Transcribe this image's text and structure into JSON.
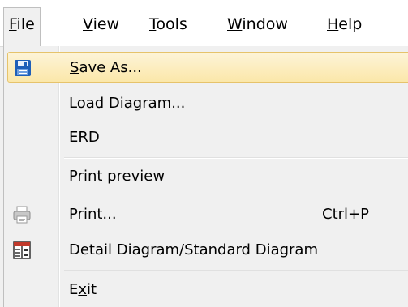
{
  "menubar": {
    "items": [
      {
        "mnemonic": "F",
        "rest": "ile"
      },
      {
        "mnemonic": "V",
        "rest": "iew"
      },
      {
        "mnemonic": "T",
        "rest": "ools"
      },
      {
        "mnemonic": "W",
        "rest": "indow"
      },
      {
        "mnemonic": "H",
        "rest": "elp"
      }
    ]
  },
  "file_menu": {
    "save_as": {
      "mnemonic": "S",
      "rest": "ave As...",
      "icon": "floppy-disk-icon"
    },
    "load_diagram": {
      "mnemonic": "L",
      "rest": "oad Diagram..."
    },
    "erd": {
      "label": "ERD"
    },
    "print_preview": {
      "label": "Print preview"
    },
    "print": {
      "mnemonic": "P",
      "rest": "rint...",
      "shortcut": "Ctrl+P",
      "icon": "printer-icon"
    },
    "detail_diagram": {
      "label": "Detail Diagram/Standard Diagram",
      "icon": "diagram-toggle-icon"
    },
    "exit": {
      "prefix": "E",
      "mnemonic": "x",
      "rest": "it"
    }
  },
  "colors": {
    "highlight": "#fbe7a9",
    "highlight_border": "#e6c36b",
    "menu_background": "#f0f0f0"
  }
}
